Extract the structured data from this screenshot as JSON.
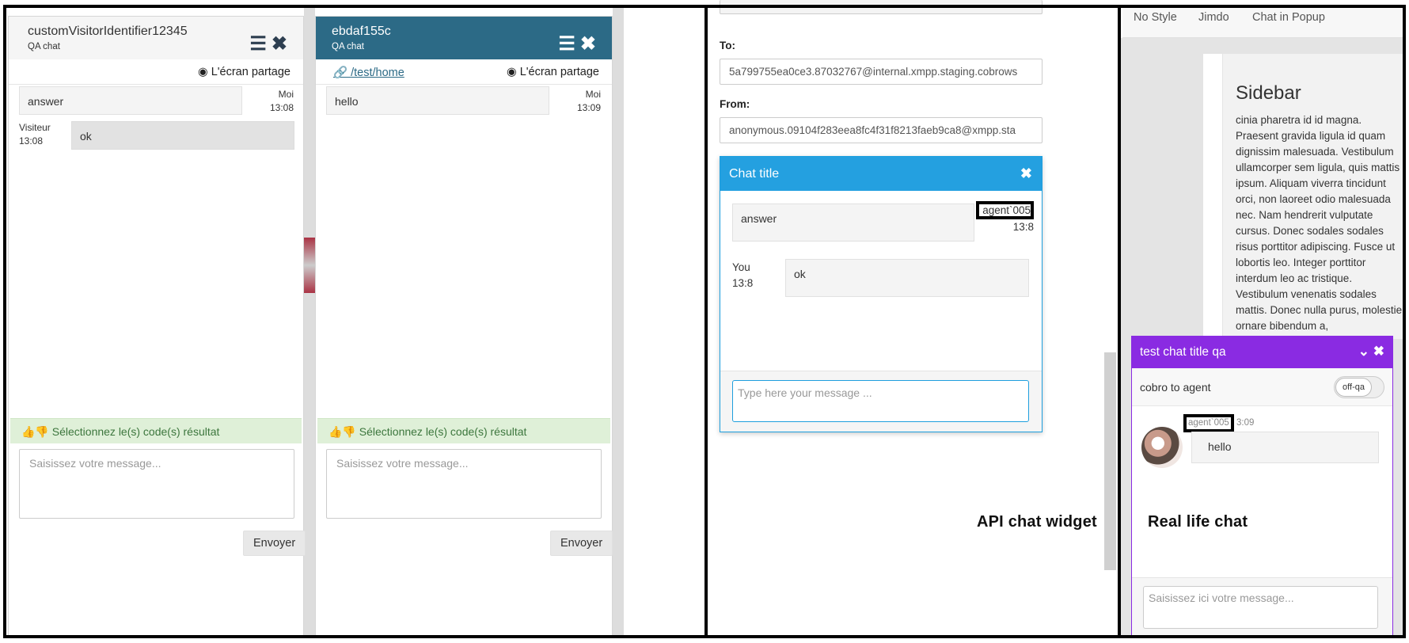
{
  "console": {
    "panel1": {
      "visitor_name": "customVisitorIdentifier12345",
      "chat_label": "QA chat",
      "share_label": "L'écran partage",
      "messages": [
        {
          "text": "answer",
          "author": "Moi",
          "time": "13:08"
        },
        {
          "text": "ok",
          "author": "Visiteur",
          "time": "13:08"
        }
      ],
      "result_codes_label": "Sélectionnez le(s) code(s) résultat",
      "message_placeholder": "Saisissez votre message...",
      "send_label": "Envoyer"
    },
    "panel2": {
      "visitor_name": "ebdaf155c",
      "chat_label": "QA chat",
      "page_link": "/test/home",
      "share_label": "L'écran partage",
      "messages": [
        {
          "text": "hello",
          "author": "Moi",
          "time": "13:09"
        }
      ],
      "result_codes_label": "Sélectionnez le(s) code(s) résultat",
      "message_placeholder": "Saisissez votre message...",
      "send_label": "Envoyer"
    }
  },
  "xmpp": {
    "to_label": "To:",
    "to_value": "5a799755ea0ce3.87032767@internal.xmpp.staging.cobrows",
    "from_label": "From:",
    "from_value": "anonymous.09104f283eea8fc4f31f8213faeb9ca8@xmpp.sta"
  },
  "api_widget": {
    "title": "Chat title",
    "messages": [
      {
        "text": "answer",
        "author": "agent`005",
        "time": "13:8"
      },
      {
        "text": "ok",
        "author": "You",
        "time": "13:8"
      }
    ],
    "input_placeholder": "Type here your message ...",
    "caption": "API chat widget"
  },
  "website": {
    "nav": [
      "No Style",
      "Jimdo",
      "Chat in Popup"
    ],
    "sidebar_title": "Sidebar",
    "sidebar_text": "cinia pharetra id id magna. Praesent gravida ligula id quam dignissim malesuada. Vestibulum ullamcorper sem ligula, quis mattis ipsum. Aliquam viverra tincidunt orci, non laoreet odio malesuada nec. Nam hendrerit vulputate cursus. Donec sodales sodales risus porttitor adipiscing. Fusce ut lobortis leo. Integer porttitor interdum leo ac tristique. Vestibulum venenatis sodales mattis. Donec nulla purus, molestie ornare bibendum a,",
    "chat": {
      "title": "test chat title qa",
      "status_text": "cobro to agent",
      "toggle_label": "off-qa",
      "agent_name": "agent`005",
      "time_partial": "3:09",
      "message": "hello",
      "caption": "Real life chat",
      "input_placeholder": "Saisissez ici votre message..."
    }
  },
  "colors": {
    "console_header_dark": "#2c6a86",
    "api_header": "#24a0e0",
    "real_chat_header": "#8a2be2",
    "result_codes_bg": "#dff0d8"
  }
}
